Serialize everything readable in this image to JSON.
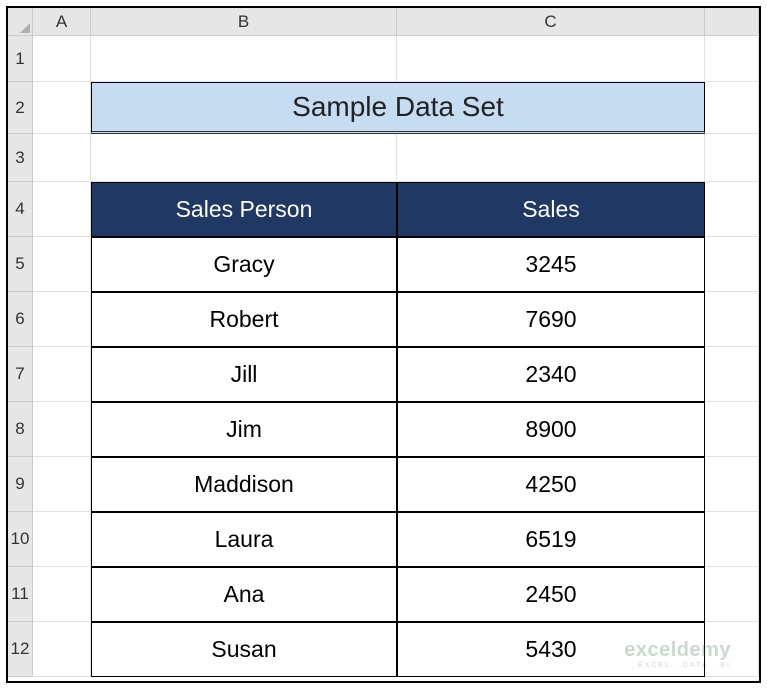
{
  "columns": [
    "A",
    "B",
    "C",
    ""
  ],
  "rows": [
    "1",
    "2",
    "3",
    "4",
    "5",
    "6",
    "7",
    "8",
    "9",
    "10",
    "11",
    "12"
  ],
  "title": "Sample Data Set",
  "table": {
    "headers": [
      "Sales Person",
      "Sales"
    ],
    "data": [
      {
        "person": "Gracy",
        "sales": "3245"
      },
      {
        "person": "Robert",
        "sales": "7690"
      },
      {
        "person": "Jill",
        "sales": "2340"
      },
      {
        "person": "Jim",
        "sales": "8900"
      },
      {
        "person": "Maddison",
        "sales": "4250"
      },
      {
        "person": "Laura",
        "sales": "6519"
      },
      {
        "person": "Ana",
        "sales": "2450"
      },
      {
        "person": "Susan",
        "sales": "5430"
      }
    ]
  },
  "watermark": {
    "main": "exceldemy",
    "sub": "EXCEL · DATA · BI"
  }
}
